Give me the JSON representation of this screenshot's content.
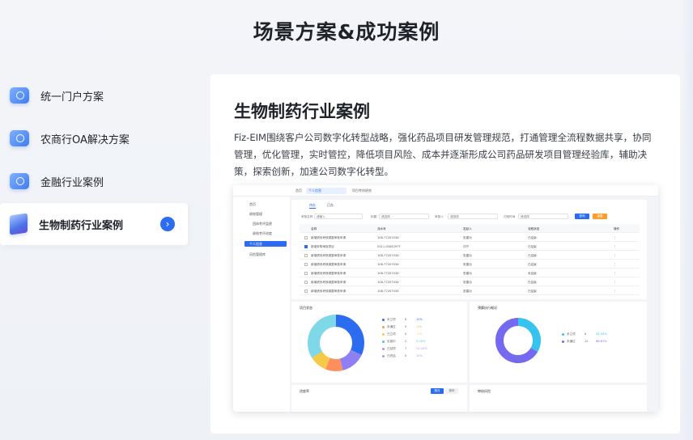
{
  "page": {
    "title": "场景方案&成功案例"
  },
  "sidebar": {
    "items": [
      {
        "label": "统一门户方案",
        "icon": "portal-icon"
      },
      {
        "label": "农商行OA解决方案",
        "icon": "bank-icon"
      },
      {
        "label": "金融行业案例",
        "icon": "finance-icon"
      },
      {
        "label": "生物制药行业案例",
        "icon": "pharma-icon",
        "active": true
      }
    ],
    "arrow": "›"
  },
  "case": {
    "title": "生物制药行业案例",
    "description": "Fiz-EIM围绕客户公司数字化转型战略，强化药品项目研发管理规范，打通管理全流程数据共享，协同管理，优化管理，实时管控，降低项目风险、成本并逐渐形成公司药品研发项目管理经验库，辅助决策，探索创新，加速公司数字化转型。"
  },
  "screenshot": {
    "tabs": [
      "首页",
      "个人信息",
      "项目考核绩效"
    ],
    "nav": [
      "首页",
      "绩效管理",
      "团体考评监察",
      "绩效考评进度",
      "个人信息",
      "风险管理库"
    ],
    "mini_tabs": [
      "待办",
      "已办"
    ],
    "filters": [
      "考核名称",
      "标题",
      "审核人",
      "归档时间"
    ],
    "placeholders": [
      "请输入",
      "请选择",
      "请选择",
      "请选择"
    ],
    "buttons": {
      "search": "查询",
      "reset": "重置"
    },
    "table": {
      "headers": [
        "名称",
        "流水号",
        "发起人",
        "流程状态",
        "操作"
      ],
      "rows": [
        [
          "新增绩效考核调整审批申请",
          "108-7720703X",
          "张建功",
          "已结束",
          "⋮"
        ],
        [
          "新增采购审批项目",
          "0311-0304297T",
          "刘宁",
          "已结束",
          "⋮"
        ],
        [
          "新增绩效考核调整审批申请",
          "108-7720703X",
          "张建功",
          "已结束",
          "⋮"
        ],
        [
          "新增绩效考核调整审批申请",
          "108-7720703X",
          "张建功",
          "已结束",
          "⋮"
        ],
        [
          "新增绩效考核调整审批申请",
          "108-7720703X",
          "张建功",
          "未结束",
          "⋮"
        ],
        [
          "新增绩效考核调整审批申请",
          "108-7720703X",
          "张建功",
          "已结束",
          "⋮"
        ],
        [
          "新增绩效考核调整审批申请",
          "108-7720703X",
          "张建功",
          "已结束",
          "⋮"
        ]
      ]
    },
    "panel_left": {
      "title": "项目状态",
      "legend": [
        {
          "name": "未立项",
          "count": "6",
          "pct": "10%",
          "color": "#2b6cf0"
        },
        {
          "name": "未通过",
          "count": "5",
          "pct": "-1%",
          "color": "#ff9c4a"
        },
        {
          "name": "已立项",
          "count": "0",
          "pct": "-1%",
          "color": "#f7c948"
        },
        {
          "name": "实施中",
          "count": "2",
          "pct": "5.00%",
          "color": "#55c4d9"
        },
        {
          "name": "已结项",
          "count": "7",
          "pct": "11.10%",
          "color": "#b88cf2"
        },
        {
          "name": "已终结",
          "count": "0",
          "pct": "10%",
          "color": "#8aa5ff"
        }
      ],
      "donut": [
        {
          "value": 32,
          "color": "#2b6cf0"
        },
        {
          "value": 14,
          "color": "#8e7ff5"
        },
        {
          "value": 10,
          "color": "#ff8f5c"
        },
        {
          "value": 10,
          "color": "#f7c948"
        },
        {
          "value": 34,
          "color": "#7fd8e8"
        }
      ]
    },
    "panel_right": {
      "title": "预算执行概况",
      "legend": [
        {
          "name": "未立项",
          "count": "6",
          "pct": "33.33%",
          "color": "#36c3ef"
        },
        {
          "name": "未通过",
          "count": "12",
          "pct": "66.67%",
          "color": "#7569ef"
        }
      ],
      "donut": [
        {
          "value": 33.33,
          "color": "#36c3ef"
        },
        {
          "value": 66.67,
          "color": "#7569ef"
        }
      ]
    },
    "panel_bottom_left": {
      "title": "进度率",
      "toggles": [
        "按月",
        "按年"
      ]
    },
    "panel_bottom_right": {
      "title": "审核风险"
    }
  }
}
